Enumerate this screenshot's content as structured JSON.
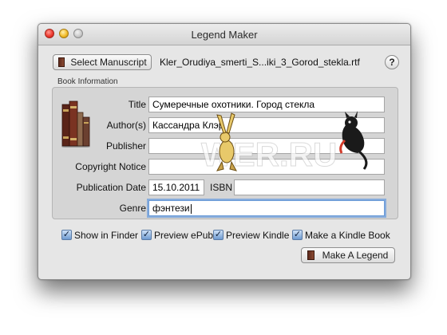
{
  "window": {
    "title": "Legend Maker"
  },
  "toolbar": {
    "select_manuscript_label": "Select Manuscript",
    "filename": "Kler_Orudiya_smerti_S...iki_3_Gorod_stekla.rtf",
    "help_label": "?"
  },
  "book_info": {
    "group_label": "Book Information",
    "title_label": "Title",
    "title_value": "Сумеречные охотники. Город стекла",
    "authors_label": "Author(s)",
    "authors_value": "Кассандра Клэр",
    "publisher_label": "Publisher",
    "publisher_value": "",
    "copyright_label": "Copyright Notice",
    "copyright_value": "",
    "pubdate_label": "Publication Date",
    "pubdate_value": "15.10.2011",
    "isbn_label": "ISBN",
    "isbn_value": "",
    "genre_label": "Genre",
    "genre_value": "фэнтези"
  },
  "options": [
    {
      "label": "Show in Finder",
      "checked": true
    },
    {
      "label": "Preview ePub",
      "checked": true
    },
    {
      "label": "Preview Kindle",
      "checked": true
    },
    {
      "label": "Make a Kindle Book",
      "checked": true
    }
  ],
  "actions": {
    "make_legend_label": "Make A Legend"
  },
  "watermark": {
    "text": "WER.RU"
  },
  "icons": {
    "books": "books-icon",
    "check": "✓"
  }
}
